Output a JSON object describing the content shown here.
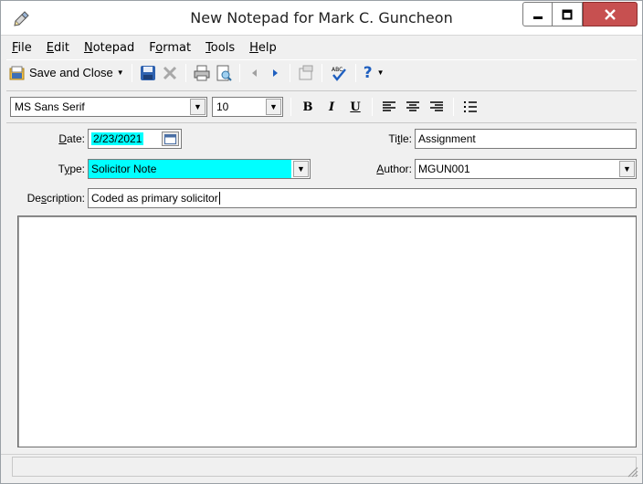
{
  "window": {
    "title": "New Notepad for Mark C. Guncheon"
  },
  "menu": {
    "items": [
      {
        "accel": "F",
        "rest": "ile"
      },
      {
        "accel": "E",
        "rest": "dit"
      },
      {
        "accel": "N",
        "rest": "otepad"
      },
      {
        "pre": "F",
        "accel": "o",
        "rest": "rmat"
      },
      {
        "accel": "T",
        "rest": "ools"
      },
      {
        "accel": "H",
        "rest": "elp"
      }
    ]
  },
  "toolbar": {
    "save_close_label": "Save and Close",
    "spell_label": "ABC"
  },
  "format": {
    "font_name": "MS Sans Serif",
    "font_size": "10",
    "bold": "B",
    "italic": "I",
    "underline": "U"
  },
  "form": {
    "date_label_pre": "",
    "date_label_accel": "D",
    "date_label_rest": "ate:",
    "date_value": "2/23/2021",
    "title_label_pre": "Ti",
    "title_label_accel": "t",
    "title_label_rest": "le:",
    "title_value": "Assignment",
    "type_label_pre": "T",
    "type_label_accel": "y",
    "type_label_rest": "pe:",
    "type_value": "Solicitor Note",
    "author_label_pre": "",
    "author_label_accel": "A",
    "author_label_rest": "uthor:",
    "author_value": "MGUN001",
    "description_label_pre": "De",
    "description_label_accel": "s",
    "description_label_rest": "cription:",
    "description_value": "Coded as primary solicitor"
  },
  "colors": {
    "highlight": "#00ffff",
    "close_button": "#c75050"
  }
}
